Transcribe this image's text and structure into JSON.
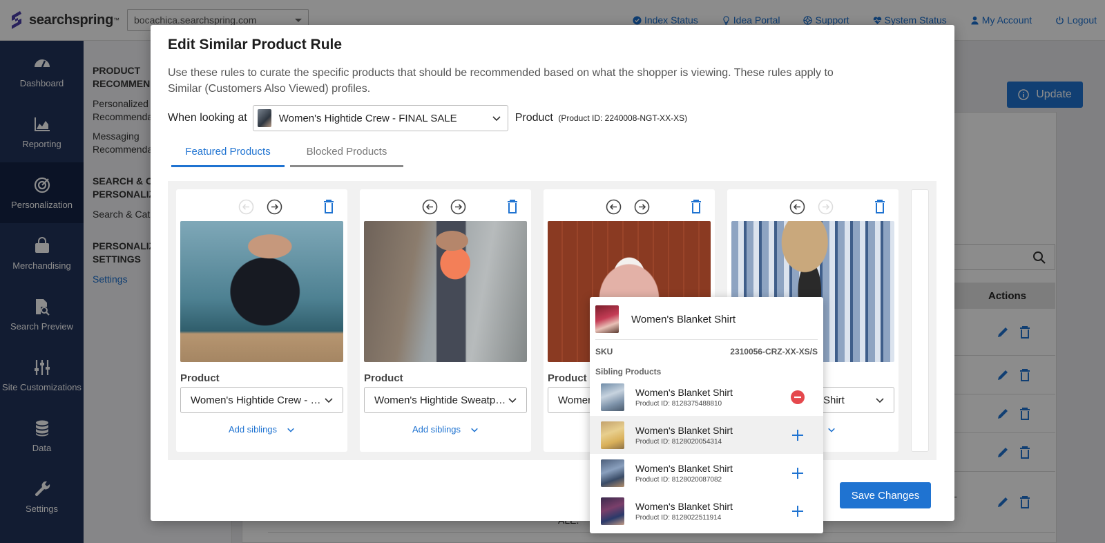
{
  "app": {
    "brand": "searchspring",
    "site_selector": "bocachica.searchspring.com",
    "top_links": [
      {
        "label": "Index Status",
        "icon": "check-circle-icon"
      },
      {
        "label": "Idea Portal",
        "icon": "lightbulb-icon"
      },
      {
        "label": "Support",
        "icon": "lifebuoy-icon"
      },
      {
        "label": "System Status",
        "icon": "heart-pulse-icon"
      },
      {
        "label": "My Account",
        "icon": "user-icon"
      },
      {
        "label": "Logout",
        "icon": "power-icon"
      }
    ]
  },
  "sidebar": {
    "items": [
      {
        "label": "Dashboard",
        "icon": "gauge-icon"
      },
      {
        "label": "Reporting",
        "icon": "area-chart-icon"
      },
      {
        "label": "Personalization",
        "icon": "target-icon",
        "active": true
      },
      {
        "label": "Merchandising",
        "icon": "shopping-bag-icon"
      },
      {
        "label": "Search Preview",
        "icon": "document-search-icon"
      },
      {
        "label": "Site Customizations",
        "icon": "sliders-icon"
      },
      {
        "label": "Data",
        "icon": "database-icon"
      },
      {
        "label": "Settings",
        "icon": "wrench-icon"
      }
    ]
  },
  "subnav": {
    "group1": "PRODUCT\nRECOMMEN",
    "link1": "Personalized\nRecommenda",
    "link2": "Messaging\nRecommenda",
    "group2": "SEARCH & CA\nPERSONALIZ",
    "link3": "Search & Cat",
    "group3": "PERSONALIZ\nSETTINGS",
    "link4": "Settings"
  },
  "background": {
    "update_label": "Update",
    "actions_header": "Actions",
    "row4_text_a": "L",
    "row4_text_b": "ALE."
  },
  "modal": {
    "title": "Edit Similar Product Rule",
    "description": "Use these rules to curate the specific products that should be recommended based on what the shopper is viewing. These rules apply to Similar (Customers Also Viewed) profiles.",
    "looking_label": "When looking at",
    "looking_value": "Women's Hightide Crew - FINAL SALE",
    "product_label": "Product",
    "product_id_text": "(Product ID: 2240008-NGT-XX-XS)",
    "tabs": [
      {
        "label": "Featured Products",
        "active": true
      },
      {
        "label": "Blocked Products",
        "active": false
      }
    ],
    "card_product_label": "Product",
    "add_siblings_label": "Add siblings",
    "cards": [
      {
        "value": "Women's Hightide Crew - FINAL SALE",
        "left_enabled": false,
        "right_enabled": true
      },
      {
        "value": "Women's Hightide Sweatpant",
        "left_enabled": true,
        "right_enabled": true
      },
      {
        "value": "Women's Blanket Shirt",
        "left_enabled": true,
        "right_enabled": true
      },
      {
        "value": "Women's Blanket Shirt",
        "left_enabled": true,
        "right_enabled": false
      }
    ],
    "card3_visible": "Womer",
    "card4_visible": "Shirt",
    "card4_addsib": "s",
    "save_label": "Save Changes"
  },
  "sibling_panel": {
    "name": "Women's Blanket Shirt",
    "sku_label": "SKU",
    "sku_value": "2310056-CRZ-XX-XS/S",
    "sibling_label": "Sibling Products",
    "rows": [
      {
        "name": "Women's Blanket Shirt",
        "id": "Product ID: 8128375488810",
        "action": "remove"
      },
      {
        "name": "Women's Blanket Shirt",
        "id": "Product ID: 8128020054314",
        "action": "add"
      },
      {
        "name": "Women's Blanket Shirt",
        "id": "Product ID: 8128020087082",
        "action": "add"
      },
      {
        "name": "Women's Blanket Shirt",
        "id": "Product ID: 8128022511914",
        "action": "add"
      }
    ]
  },
  "colors": {
    "primary": "#1f73d1",
    "sidebar": "#22335c",
    "remove": "#e5484d"
  }
}
